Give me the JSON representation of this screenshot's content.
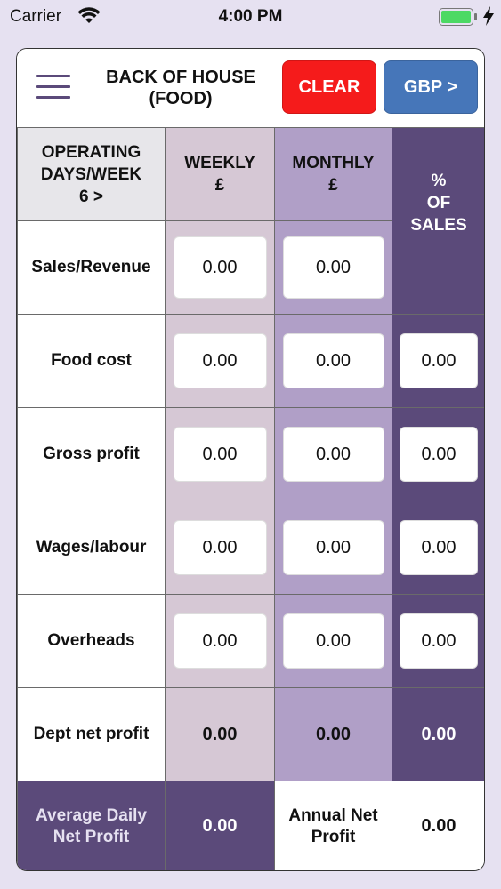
{
  "status": {
    "carrier": "Carrier",
    "time": "4:00 PM"
  },
  "header": {
    "title_line1": "BACK OF HOUSE",
    "title_line2": "(FOOD)",
    "clear_label": "CLEAR",
    "currency_label": "GBP >"
  },
  "columns": {
    "operating_days_line1": "OPERATING",
    "operating_days_line2": "DAYS/WEEK",
    "operating_days_value": "6 >",
    "weekly_line1": "WEEKLY",
    "weekly_line2": "£",
    "monthly_line1": "MONTHLY",
    "monthly_line2": "£",
    "pct_line1": "%",
    "pct_line2": "OF",
    "pct_line3": "SALES"
  },
  "rows": [
    {
      "label": "Sales/Revenue",
      "weekly": "0.00",
      "monthly": "0.00",
      "pct": ""
    },
    {
      "label": "Food cost",
      "weekly": "0.00",
      "monthly": "0.00",
      "pct": "0.00"
    },
    {
      "label": "Gross profit",
      "weekly": "0.00",
      "monthly": "0.00",
      "pct": "0.00"
    },
    {
      "label": "Wages/labour",
      "weekly": "0.00",
      "monthly": "0.00",
      "pct": "0.00"
    },
    {
      "label": "Overheads",
      "weekly": "0.00",
      "monthly": "0.00",
      "pct": "0.00"
    }
  ],
  "dept_net_profit": {
    "label": "Dept net profit",
    "weekly": "0.00",
    "monthly": "0.00",
    "pct": "0.00"
  },
  "footer": {
    "avg_label_line1": "Average Daily",
    "avg_label_line2": "Net Profit",
    "avg_value": "0.00",
    "annual_label_line1": "Annual Net",
    "annual_label_line2": "Profit",
    "annual_value": "0.00"
  }
}
